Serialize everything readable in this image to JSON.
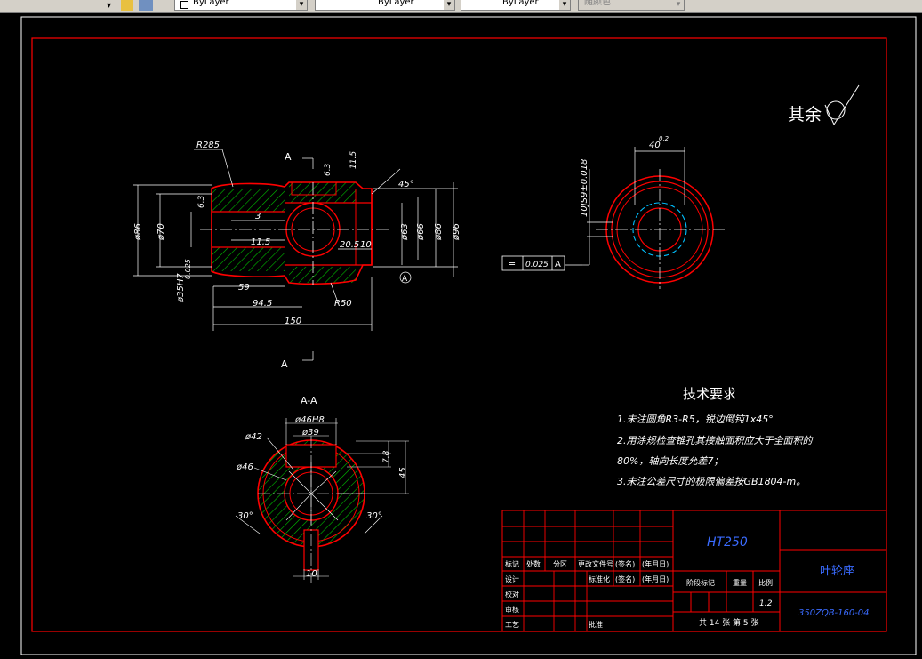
{
  "toolbar": {
    "linetype_value": "ByLayer",
    "lineweight_value": "ByLayer",
    "linestyle_value": "ByLayer",
    "color_value": "随颜色"
  },
  "drawing": {
    "roughness_note": "其余",
    "dims_main": {
      "r285": "R285",
      "sec_a_top": "A",
      "sec_a_bottom": "A",
      "d63_top": "6.3",
      "d11_5_top": "11.5",
      "angle45": "45°",
      "d63_left": "6.3",
      "d3": "3",
      "d11_5": "11.5",
      "d20_5": "20.5",
      "d10": "10",
      "dia86": "ø86",
      "dia70": "ø70",
      "dia35": "ø35H7",
      "tol35": "0.025",
      "dia63": "ø63",
      "dia66": "ø66",
      "dia86r": "ø86",
      "dia96": "ø96",
      "datum_a": "A",
      "d59": "59",
      "d94_5": "94.5",
      "d150": "150",
      "r50": "R50"
    },
    "dims_side": {
      "d40": "40",
      "d40_tol": "0.2",
      "tol_text": "10JS9±0.018",
      "frame_symbol": "=",
      "frame_value": "0.025",
      "frame_datum": "A"
    },
    "section": {
      "title": "A-A",
      "dia46h8": "ø46H8",
      "dia39": "ø39",
      "dia42": "ø42",
      "dia46": "ø46",
      "d7_8": "7.8",
      "d45": "45",
      "angle30_left": "30°",
      "angle30_right": "30°",
      "d10": "10"
    },
    "tech_req": {
      "title": "技术要求",
      "line1": "1.未注圆角R3-R5，锐边倒钝1x45°",
      "line2": "2.用涂规检查锥孔其接触面积应大于全面积的",
      "line3": "80%，轴向长度允差7；",
      "line4": "3.未注公差尺寸的极限偏差按GB1804-m。"
    },
    "title_block": {
      "material": "HT250",
      "part_name": "叶轮座",
      "drawing_no": "350ZQB-160-04",
      "scale": "1:2",
      "sheets": "共 14 张  第 5 张",
      "h_mark": "标记",
      "h_count": "处数",
      "h_zone": "分区",
      "h_docno": "更改文件号",
      "h_sign": "(签名)",
      "h_date": "(年月日)",
      "h_design": "设计",
      "h_std": "标准化",
      "h_sign2": "(签名)",
      "h_date2": "(年月日)",
      "h_check": "校对",
      "h_review": "审核",
      "h_process": "工艺",
      "h_approve": "批准",
      "h_stage": "阶段标记",
      "h_weight": "重量",
      "h_ratio": "比例"
    }
  }
}
